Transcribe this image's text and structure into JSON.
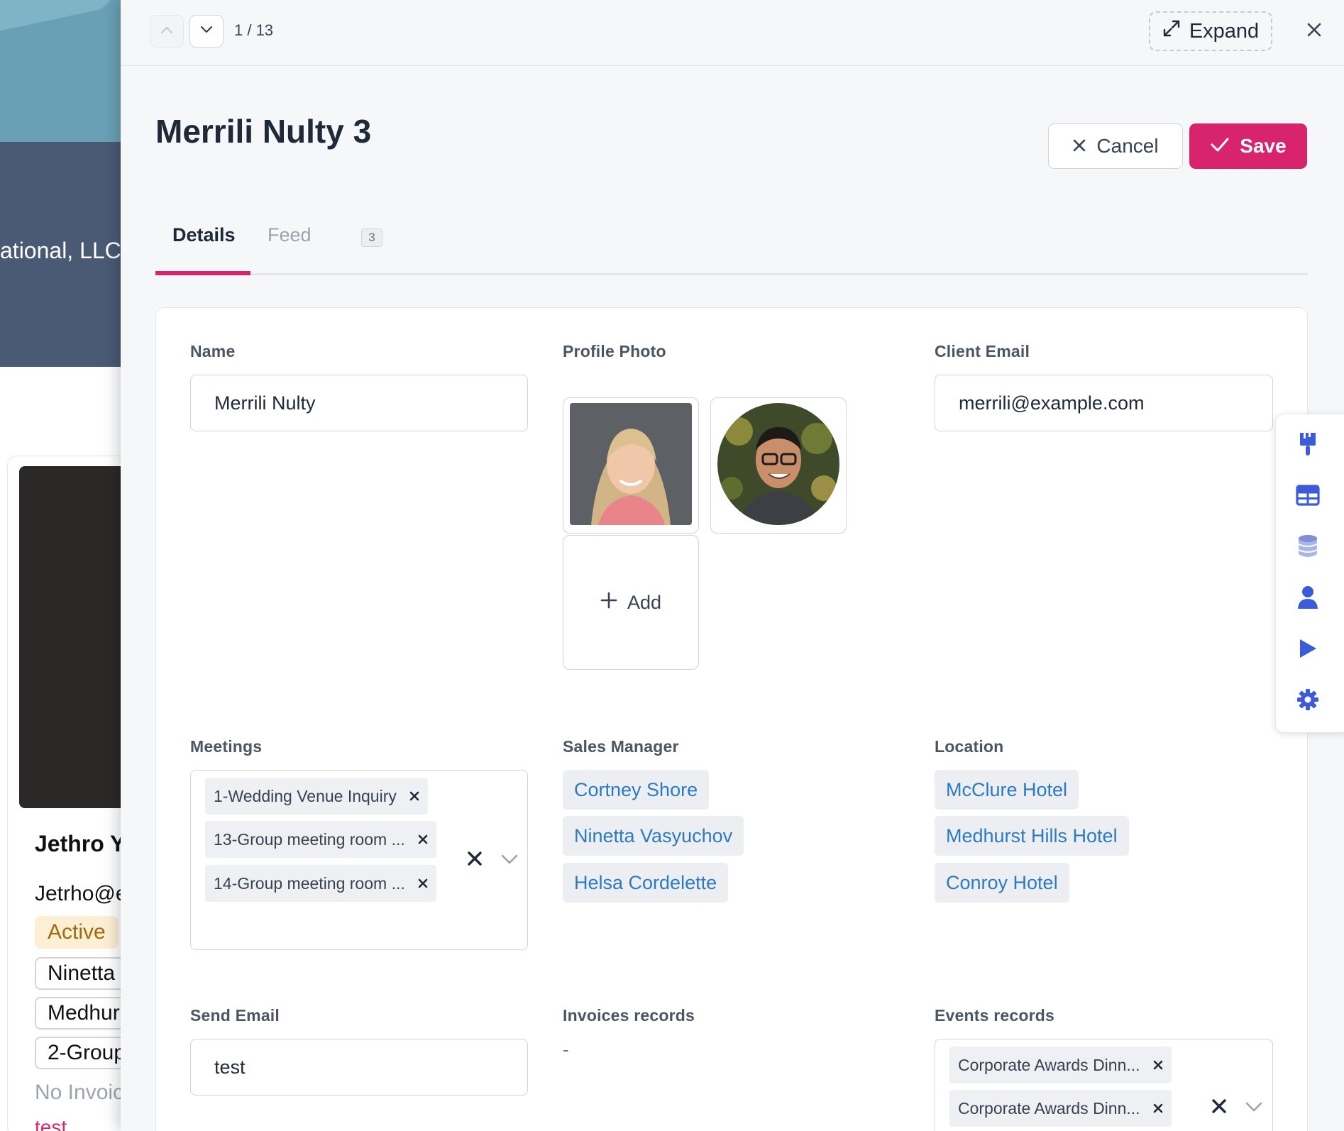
{
  "background": {
    "hero_text": "ational, LLC",
    "card": {
      "name": "Jethro Y",
      "email": "Jetrho@e",
      "status": "Active",
      "pill1": "Ninetta",
      "pill2": "Medhur",
      "pill3": "2-Group",
      "muted": "No Invoic",
      "link": "test"
    }
  },
  "drawer": {
    "counter": "1 / 13",
    "expand_label": "Expand",
    "title": "Merrili Nulty 3",
    "cancel_label": "Cancel",
    "save_label": "Save",
    "tabs": [
      {
        "label": "Details",
        "active": true
      },
      {
        "label": "Feed",
        "count": "3",
        "active": false
      }
    ]
  },
  "form": {
    "name": {
      "label": "Name",
      "value": "Merrili Nulty"
    },
    "profile_photo": {
      "label": "Profile Photo",
      "add_label": "Add"
    },
    "client_email": {
      "label": "Client Email",
      "value": "merrili@example.com"
    },
    "meetings": {
      "label": "Meetings",
      "items": [
        "1-Wedding Venue Inquiry",
        "13-Group meeting room ...",
        "14-Group meeting room ..."
      ]
    },
    "sales_manager": {
      "label": "Sales Manager",
      "items": [
        "Cortney Shore",
        "Ninetta Vasyuchov",
        "Helsa Cordelette"
      ]
    },
    "location": {
      "label": "Location",
      "items": [
        "McClure Hotel",
        "Medhurst Hills Hotel",
        "Conroy Hotel"
      ]
    },
    "send_email": {
      "label": "Send Email",
      "value": "test"
    },
    "invoices_records": {
      "label": "Invoices records",
      "value": "-"
    },
    "events_records": {
      "label": "Events records",
      "items": [
        "Corporate Awards Dinn...",
        "Corporate Awards Dinn..."
      ]
    }
  },
  "colors": {
    "accent": "#d8246d",
    "link": "#2b7bc4",
    "tool_icon": "#3b5bdb"
  },
  "icons": {
    "side_tools": [
      "paint-brush-icon",
      "table-icon",
      "database-icon",
      "user-icon",
      "play-icon",
      "gear-icon"
    ]
  }
}
